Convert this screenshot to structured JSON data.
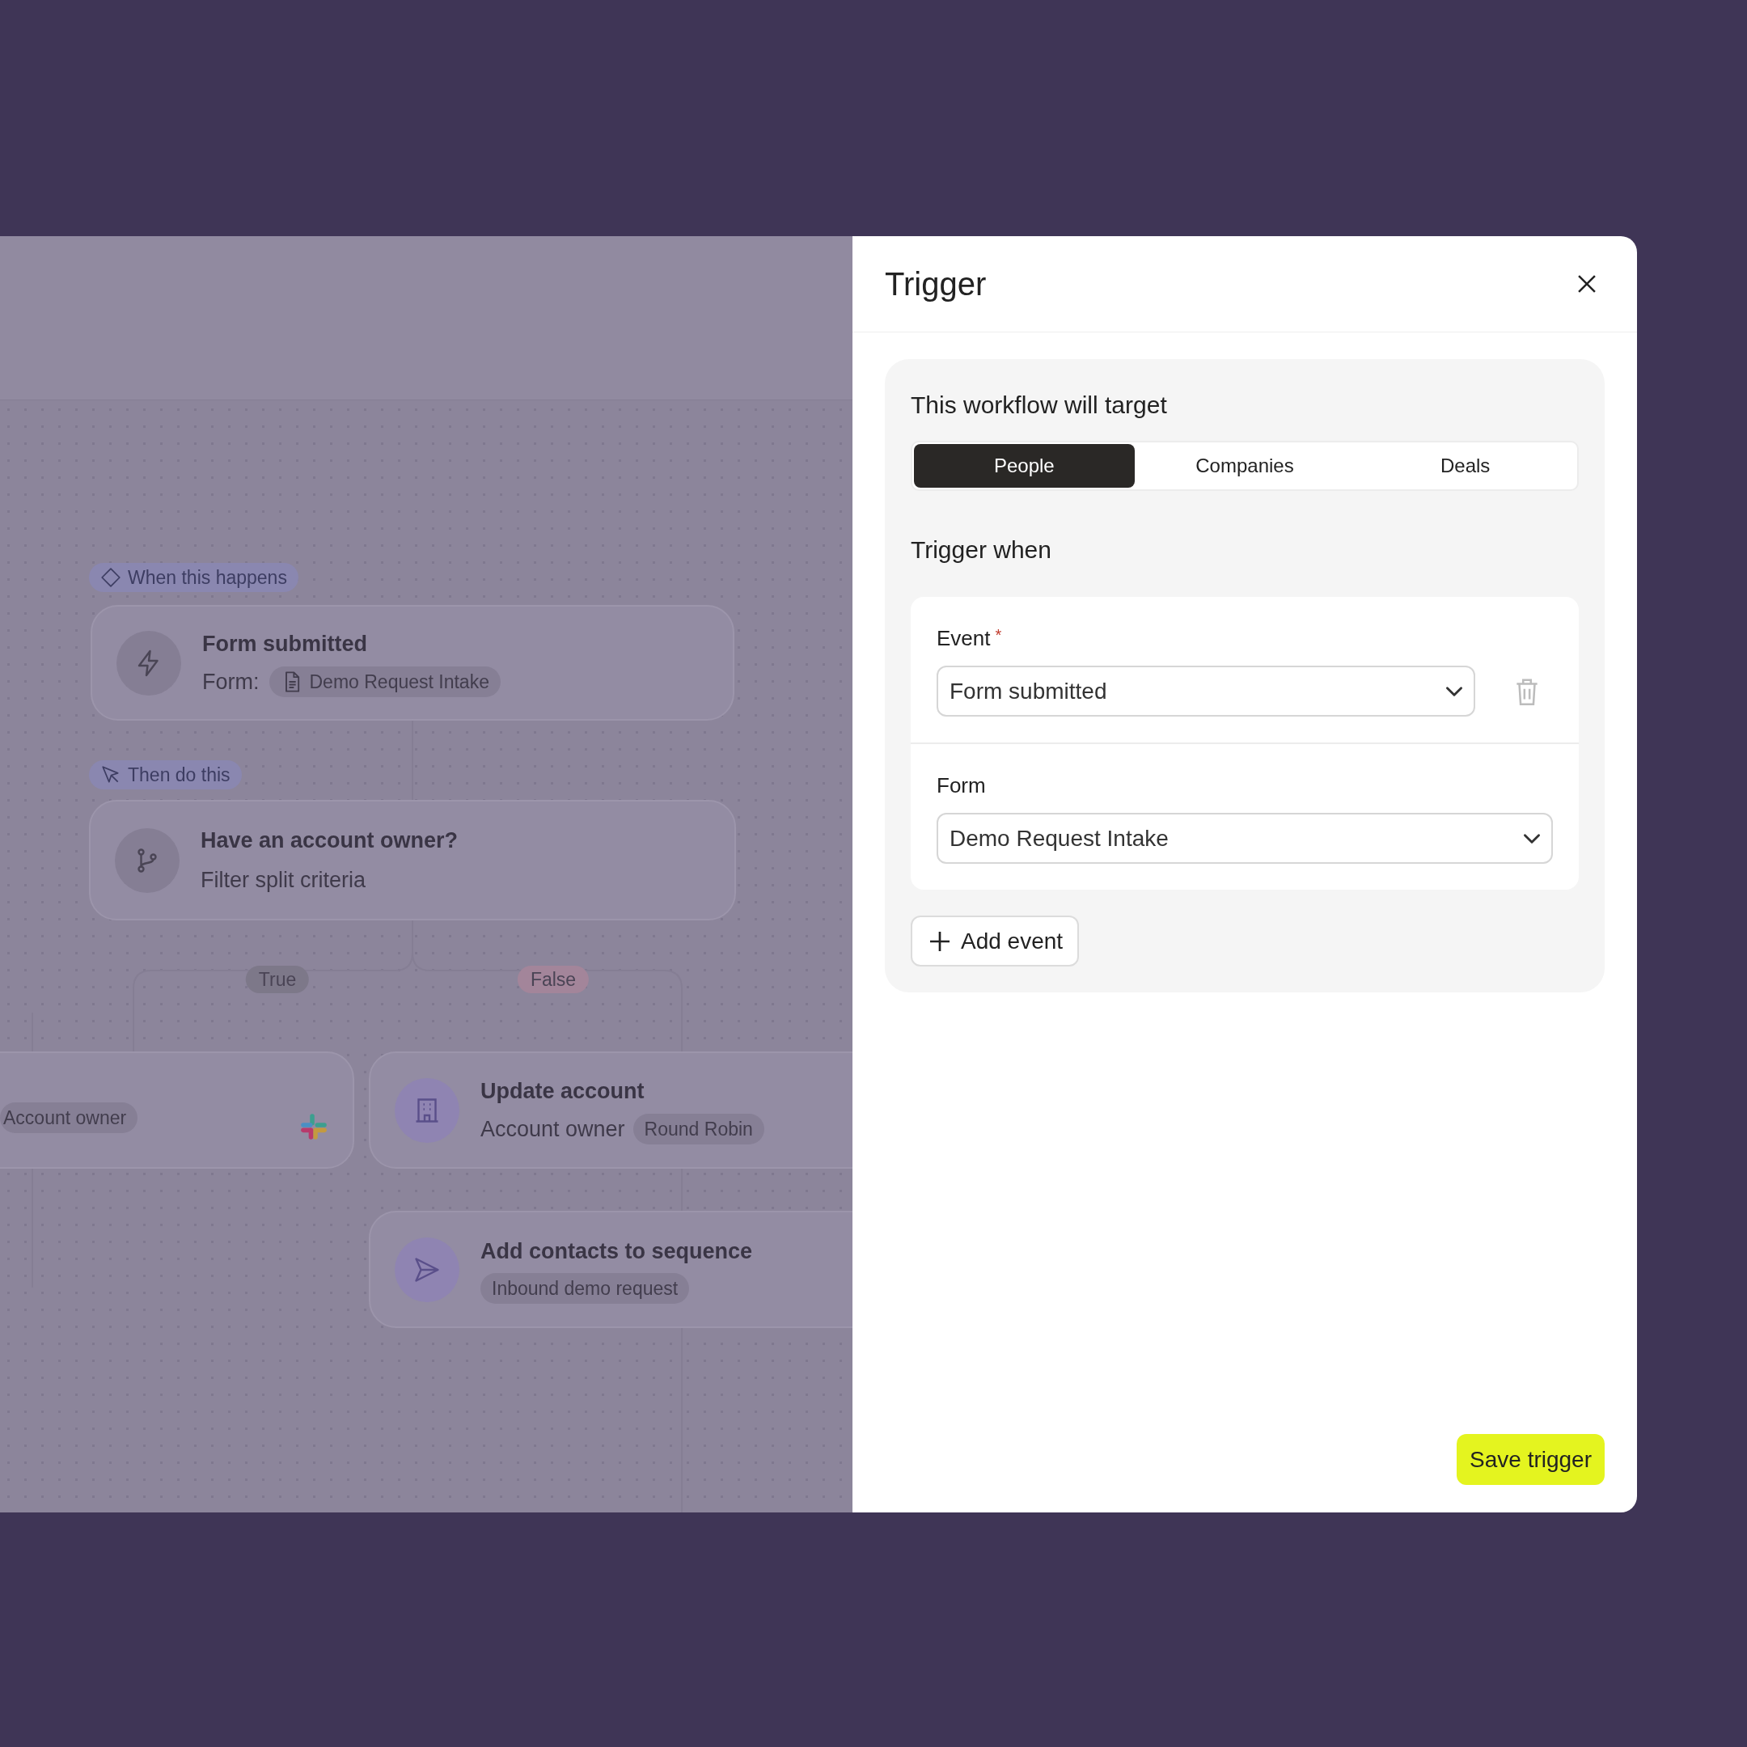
{
  "canvas": {
    "trigger_label": "When this happens",
    "trigger_card": {
      "title": "Form submitted",
      "field": "Form:",
      "chip": "Demo Request Intake"
    },
    "action_label": "Then do this",
    "filter_card": {
      "title": "Have an account owner?",
      "subtitle": "Filter split criteria"
    },
    "branches": [
      {
        "label": "True",
        "color": "#7d7889"
      },
      {
        "label": "False",
        "color": "#a3859a"
      }
    ],
    "cards": [
      {
        "kind": "partial",
        "chip": "Account owner"
      },
      {
        "kind": "update",
        "title": "Update account",
        "subtitle": "Account owner",
        "chip": "Round Robin"
      },
      {
        "kind": "sequence",
        "title": "Add contacts to sequence",
        "chip": "Inbound demo request"
      }
    ]
  },
  "panel": {
    "title": "Trigger",
    "target_heading": "This workflow will target",
    "tabs": [
      {
        "label": "People",
        "selected": true
      },
      {
        "label": "Companies",
        "selected": false
      },
      {
        "label": "Deals",
        "selected": false
      }
    ],
    "trigger_heading": "Trigger when",
    "fields": [
      {
        "label": "Event",
        "required_mark": "*",
        "value": "Form submitted",
        "removable": true
      },
      {
        "label": "Form",
        "value": "Demo Request Intake",
        "removable": false
      }
    ],
    "add_button": "Add event",
    "save_button": "Save trigger"
  }
}
